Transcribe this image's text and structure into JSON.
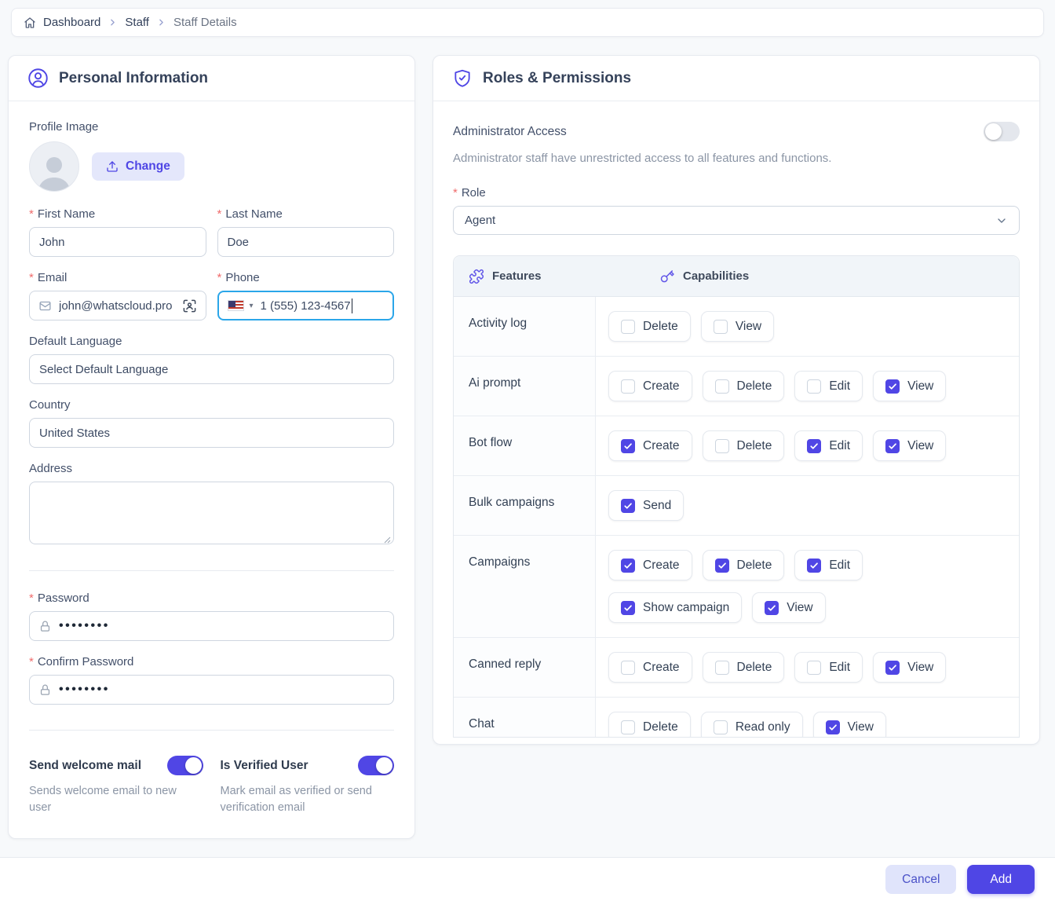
{
  "required_marker": "*",
  "colors": {
    "accent": "#4f46e5",
    "accent_light": "#e0e4fb",
    "focus_blue": "#2ba6e9",
    "toggle_off": "#e4e7ed"
  },
  "icons": {
    "flag_caret": "▾"
  },
  "breadcrumb": {
    "items": [
      {
        "label": "Dashboard"
      },
      {
        "label": "Staff"
      },
      {
        "label": "Staff Details"
      }
    ]
  },
  "personal": {
    "title": "Personal Information",
    "profile_image_label": "Profile Image",
    "change_button": "Change",
    "fields": {
      "first_name": {
        "label": "First Name",
        "value": "John"
      },
      "last_name": {
        "label": "Last Name",
        "value": "Doe"
      },
      "email": {
        "label": "Email",
        "value": "john@whatscloud.pro"
      },
      "phone": {
        "label": "Phone",
        "value": "1 (555) 123-4567"
      },
      "default_language": {
        "label": "Default Language",
        "placeholder": "Select Default Language"
      },
      "country": {
        "label": "Country",
        "value": "United States"
      },
      "address": {
        "label": "Address",
        "value": ""
      },
      "password": {
        "label": "Password",
        "value": "••••••••"
      },
      "confirm_password": {
        "label": "Confirm Password",
        "value": "••••••••"
      }
    },
    "toggles": {
      "send_welcome_mail": {
        "label": "Send welcome mail",
        "description": "Sends welcome email to new user",
        "on": true
      },
      "is_verified_user": {
        "label": "Is Verified User",
        "description": "Mark email as verified or send verification email",
        "on": true
      }
    }
  },
  "roles": {
    "title": "Roles & Permissions",
    "admin_access": {
      "label": "Administrator Access",
      "description": "Administrator staff have unrestricted access to all features and functions.",
      "on": false
    },
    "role": {
      "label": "Role",
      "value": "Agent"
    },
    "table": {
      "features_header": "Features",
      "capabilities_header": "Capabilities",
      "rows": [
        {
          "feature": "Activity log",
          "capabilities": [
            {
              "label": "Delete",
              "checked": false
            },
            {
              "label": "View",
              "checked": false
            }
          ]
        },
        {
          "feature": "Ai prompt",
          "capabilities": [
            {
              "label": "Create",
              "checked": false
            },
            {
              "label": "Delete",
              "checked": false
            },
            {
              "label": "Edit",
              "checked": false
            },
            {
              "label": "View",
              "checked": true
            }
          ]
        },
        {
          "feature": "Bot flow",
          "capabilities": [
            {
              "label": "Create",
              "checked": true
            },
            {
              "label": "Delete",
              "checked": false
            },
            {
              "label": "Edit",
              "checked": true
            },
            {
              "label": "View",
              "checked": true
            }
          ]
        },
        {
          "feature": "Bulk campaigns",
          "capabilities": [
            {
              "label": "Send",
              "checked": true
            }
          ]
        },
        {
          "feature": "Campaigns",
          "capabilities": [
            {
              "label": "Create",
              "checked": true
            },
            {
              "label": "Delete",
              "checked": true
            },
            {
              "label": "Edit",
              "checked": true
            },
            {
              "label": "Show campaign",
              "checked": true
            },
            {
              "label": "View",
              "checked": true
            }
          ]
        },
        {
          "feature": "Canned reply",
          "capabilities": [
            {
              "label": "Create",
              "checked": false
            },
            {
              "label": "Delete",
              "checked": false
            },
            {
              "label": "Edit",
              "checked": false
            },
            {
              "label": "View",
              "checked": true
            }
          ]
        },
        {
          "feature": "Chat",
          "capabilities": [
            {
              "label": "Delete",
              "checked": false
            },
            {
              "label": "Read only",
              "checked": false
            },
            {
              "label": "View",
              "checked": true
            }
          ]
        }
      ]
    }
  },
  "footer": {
    "cancel_label": "Cancel",
    "add_label": "Add"
  }
}
